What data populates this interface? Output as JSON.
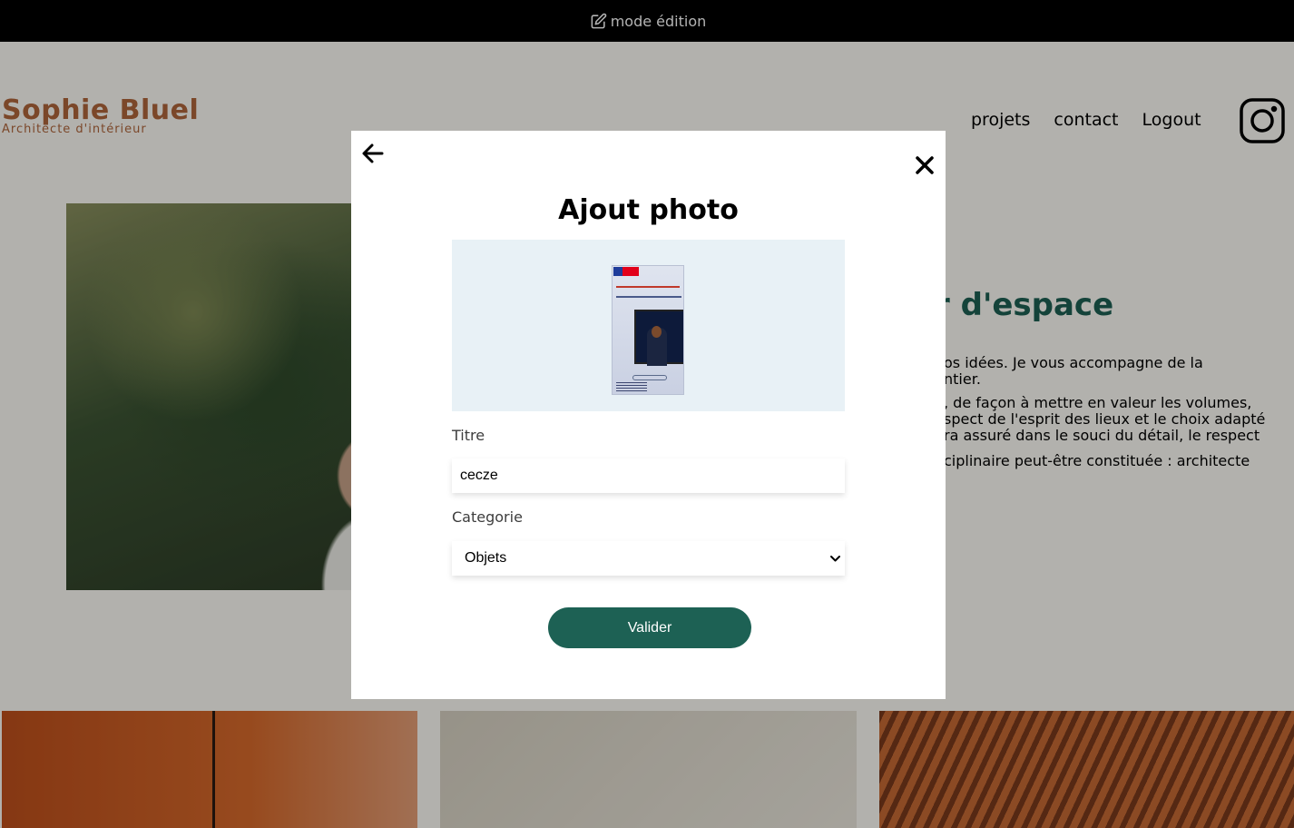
{
  "edit_bar": {
    "label": "mode édition",
    "icon": "edit-icon"
  },
  "brand": {
    "name": "Sophie Bluel",
    "subtitle": "Architecte d'intérieur",
    "color": "#b1663c"
  },
  "nav": {
    "items": [
      "projets",
      "contact",
      "Logout"
    ],
    "social_icon": "instagram-icon"
  },
  "intro": {
    "title_partial": "r d'espace",
    "paragraphs": [
      "os idées. Je vous accompagne de la",
      "ntier.",
      ", de façon à mettre en valeur les volumes,",
      "spect de l'esprit des lieux et le choix adapté",
      "ra assuré dans le souci du détail, le respect",
      "ciplinaire peut-être constituée : architecte"
    ],
    "title_color": "#1d6154"
  },
  "modal": {
    "back_icon": "arrow-left-icon",
    "close_icon": "close-icon",
    "title": "Ajout photo",
    "preview_alt": "uploaded-image-preview",
    "title_field": {
      "label": "Titre",
      "value": "cecze"
    },
    "category_field": {
      "label": "Categorie",
      "selected": "Objets"
    },
    "submit_label": "Valider",
    "accent": "#1d6154",
    "upload_bg": "#e8f1f6"
  }
}
